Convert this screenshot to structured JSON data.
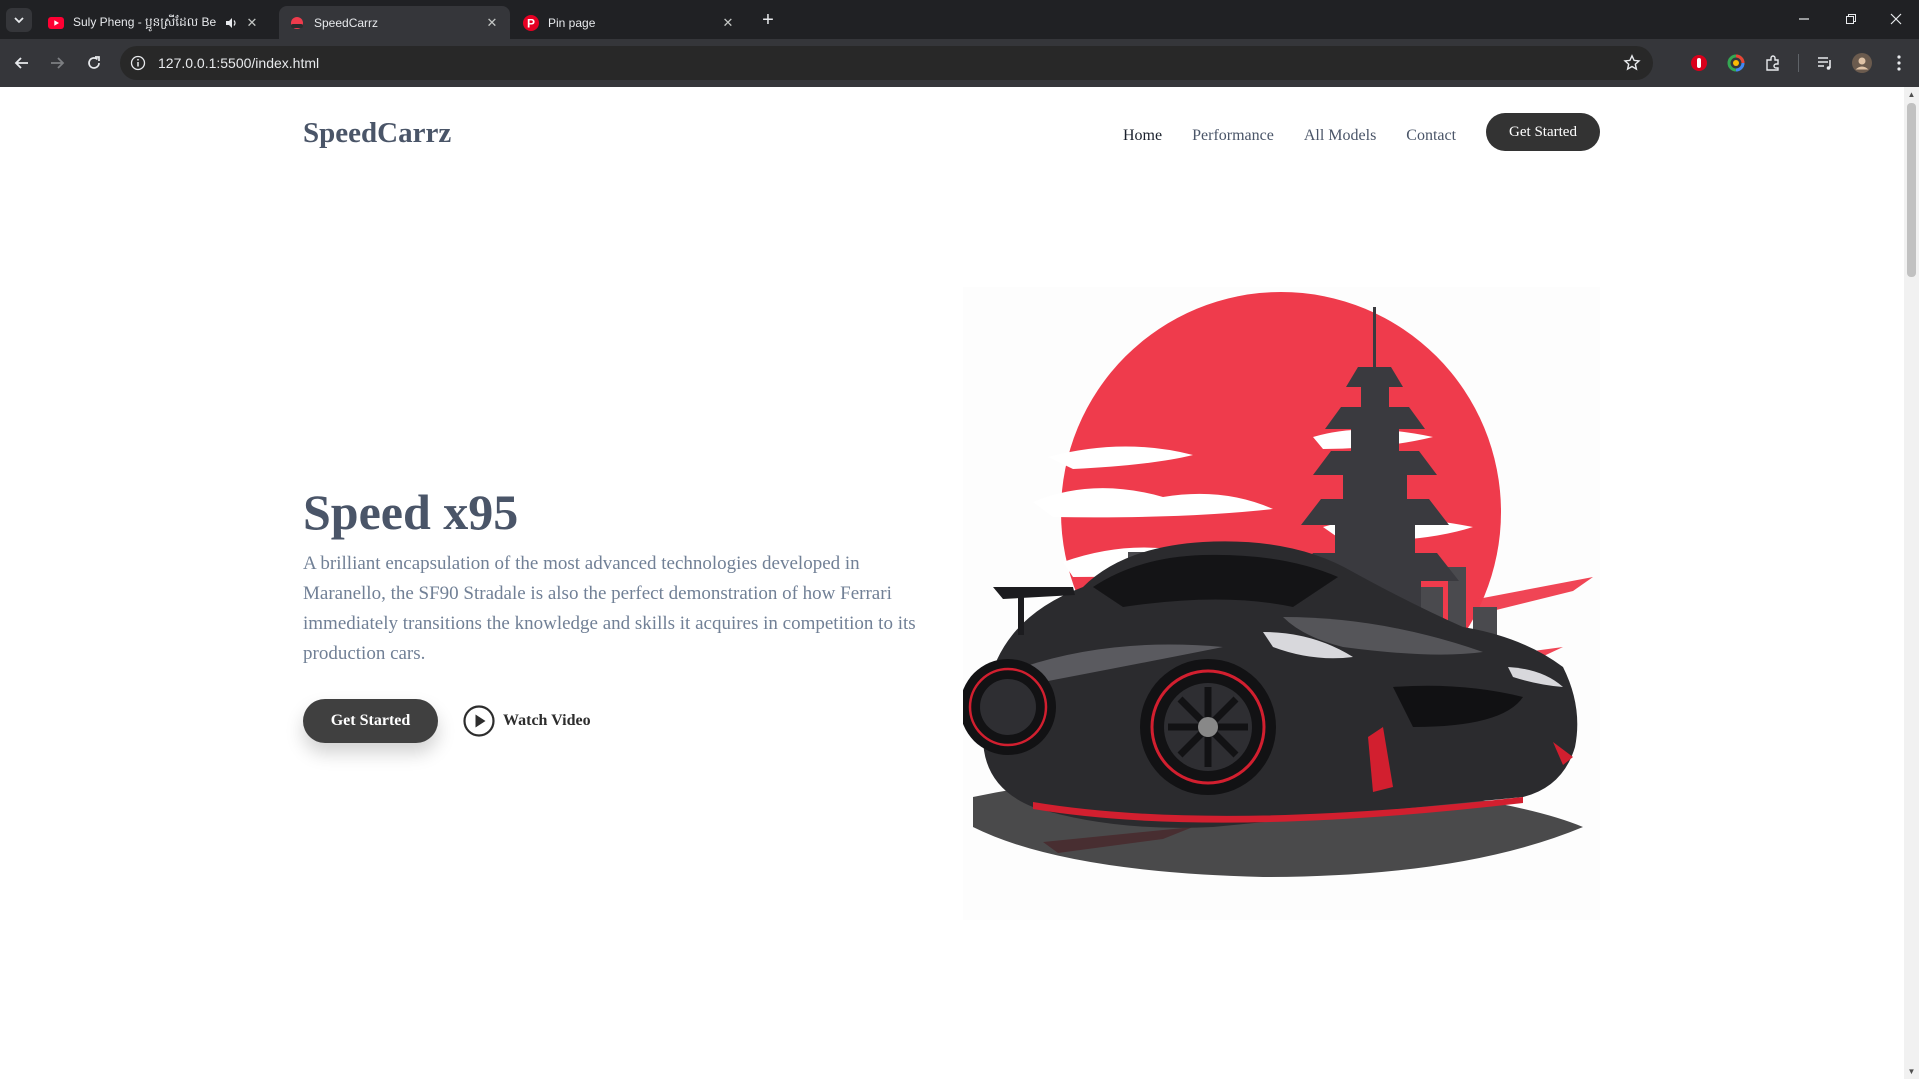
{
  "browser": {
    "tabs": [
      {
        "title": "Suly Pheng - ប្អូនស្រីដែល Be",
        "icon": "youtube-icon",
        "audio": true,
        "active": false
      },
      {
        "title": "SpeedCarrz",
        "icon": "site-favicon",
        "audio": false,
        "active": true
      },
      {
        "title": "Pin page",
        "icon": "pinterest-icon",
        "audio": false,
        "active": false
      }
    ],
    "url": "127.0.0.1:5500/index.html"
  },
  "site": {
    "logo": "SpeedCarrz",
    "nav": [
      "Home",
      "Performance",
      "All Models",
      "Contact"
    ],
    "header_cta": "Get Started"
  },
  "hero": {
    "title": "Speed x95",
    "description": "A brilliant encapsulation of the most advanced technologies developed in Maranello, the SF90 Stradale is also the perfect demonstration of how Ferrari immediately transitions the knowledge and skills it acquires in competition to its production cars.",
    "cta": "Get Started",
    "watch_label": "Watch Video",
    "image_icon": "sports-car-illustration",
    "colors": {
      "sun": "#ef3b4c",
      "car": "#2b2b2e",
      "accent": "#d21f2f"
    }
  }
}
